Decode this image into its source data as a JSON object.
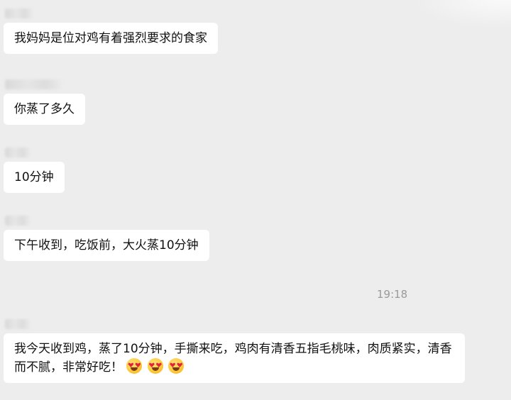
{
  "messages": [
    {
      "text": "我妈妈是位对鸡有着强烈要求的食家"
    },
    {
      "text": "你蒸了多久"
    },
    {
      "text": "10分钟"
    },
    {
      "text": "下午收到，吃饭前，大火蒸10分钟"
    },
    {
      "text": "我今天收到鸡，蒸了10分钟，手撕来吃，鸡肉有清香五指毛桃味，肉质紧实，清香而不腻，非常好吃！",
      "emojis": [
        "heart-eyes-face",
        "heart-eyes-face",
        "heart-eyes-face"
      ]
    }
  ],
  "timestamp": "19:18"
}
